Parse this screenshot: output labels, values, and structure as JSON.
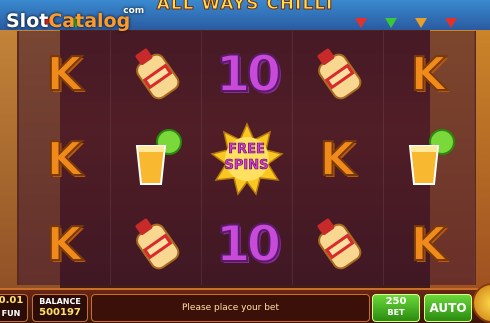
{
  "game": {
    "title": "ALL WAYS CHILLI",
    "watermark": {
      "part1": "Slot",
      "part2": "Catalog",
      "suffix": "com"
    }
  },
  "reels": [
    [
      "K",
      "K",
      "K"
    ],
    [
      "tequila",
      "tequila-shot",
      "tequila"
    ],
    [
      "10",
      "FREE SPINS",
      "10"
    ],
    [
      "tequila",
      "K",
      "tequila"
    ],
    [
      "K",
      "tequila-shot",
      "K"
    ]
  ],
  "free_spins": {
    "line1": "FREE",
    "line2": "SPINS"
  },
  "bottom": {
    "coin_value": "0.01",
    "coin_unit": "FUN",
    "balance_label": "BALANCE",
    "balance_value": "500197",
    "message": "Please place your bet",
    "bet_value": "250",
    "bet_label": "BET",
    "auto_label": "AUTO"
  },
  "colors": {
    "k_symbol": "#f08a1a",
    "ten_symbol": "#c84ad8",
    "button_green": "#4ab820",
    "frame_accent": "#c8702a"
  }
}
